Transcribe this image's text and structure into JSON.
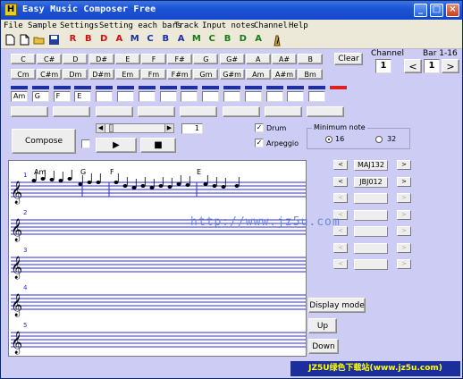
{
  "window": {
    "title": "Easy Music Composer Free",
    "icon": "H",
    "min": "_",
    "max": "□",
    "close": "×"
  },
  "menu": [
    "File",
    "Sample",
    "Settings",
    "Setting each bars",
    "Track",
    "Input notes",
    "Channel",
    "Help"
  ],
  "toolbar": {
    "new": "new-icon",
    "new2": "new-document-icon",
    "open": "open-folder-icon",
    "save": "save-disk-icon",
    "letters": [
      {
        "t": "R",
        "c": "#cc1111"
      },
      {
        "t": "B",
        "c": "#cc1111"
      },
      {
        "t": "D",
        "c": "#cc1111"
      },
      {
        "t": "A",
        "c": "#cc1111"
      },
      {
        "t": "M",
        "c": "#1a2fb0"
      },
      {
        "t": "C",
        "c": "#1a2fb0"
      },
      {
        "t": "B",
        "c": "#1a2fb0"
      },
      {
        "t": "A",
        "c": "#1a2fb0"
      },
      {
        "t": "M",
        "c": "#1a7a1a"
      },
      {
        "t": "C",
        "c": "#1a7a1a"
      },
      {
        "t": "B",
        "c": "#1a7a1a"
      },
      {
        "t": "D",
        "c": "#1a7a1a"
      },
      {
        "t": "A",
        "c": "#1a7a1a"
      }
    ],
    "metronome": "metronome-icon"
  },
  "notes": [
    "C",
    "C#",
    "D",
    "D#",
    "E",
    "F",
    "F#",
    "G",
    "G#",
    "A",
    "A#",
    "B"
  ],
  "chords": [
    "Cm",
    "C#m",
    "Dm",
    "D#m",
    "Em",
    "Fm",
    "F#m",
    "Gm",
    "G#m",
    "Am",
    "A#m",
    "Bm"
  ],
  "clear": "Clear",
  "channel": {
    "label": "Channel",
    "value": "1"
  },
  "bar": {
    "label": "Bar 1-16",
    "value": "1",
    "prev": "<",
    "next": ">"
  },
  "bar_chords": [
    "Am",
    "G",
    "F",
    "E",
    "",
    "",
    "",
    "",
    "",
    "",
    "",
    "",
    "",
    "",
    "",
    ""
  ],
  "compose": "Compose",
  "play": "▶",
  "stop": "■",
  "tempo_value": "1",
  "drum": "Drum",
  "arpeggio": "Arpeggio",
  "min_note": {
    "label": "Minimum note",
    "opt1": "16",
    "opt2": "32"
  },
  "tracks": [
    {
      "name": "MAJ132",
      "enabled": true
    },
    {
      "name": "JBJ012",
      "enabled": true
    },
    {
      "name": "",
      "enabled": false
    },
    {
      "name": "",
      "enabled": false
    },
    {
      "name": "",
      "enabled": false
    },
    {
      "name": "",
      "enabled": false
    },
    {
      "name": "",
      "enabled": false
    }
  ],
  "staff": {
    "measures": [
      "1",
      "2",
      "3",
      "4",
      "5"
    ],
    "chord_labels": [
      "Am",
      "G",
      "F",
      "E"
    ]
  },
  "display_mode": "Display mode",
  "up": "Up",
  "down": "Down",
  "watermark": "http://www.jz5u.com",
  "banner": "JZ5U绿色下载站(www.jz5u.com)"
}
